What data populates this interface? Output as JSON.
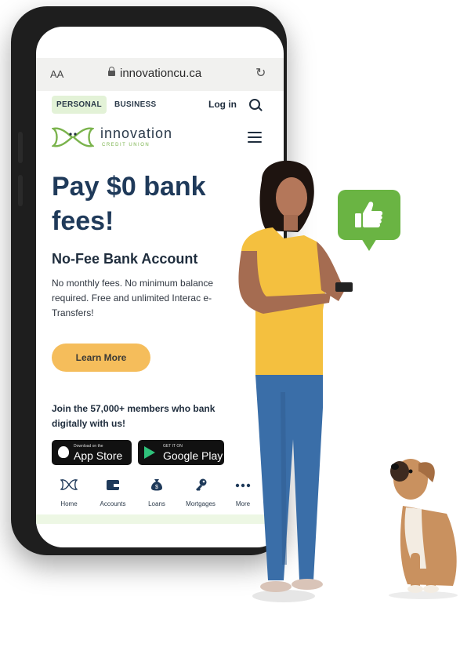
{
  "browser": {
    "text_size_label": "AA",
    "url": "innovationcu.ca"
  },
  "nav": {
    "personal": "PERSONAL",
    "business": "BUSINESS",
    "login": "Log in"
  },
  "logo": {
    "name": "innovation",
    "tagline": "CREDIT UNION"
  },
  "hero": {
    "title": "Pay $0 bank fees!",
    "subtitle": "No-Fee Bank Account",
    "description": "No monthly fees. No minimum balance required. Free and unlimited Interac e-Transfers!",
    "cta": "Learn More"
  },
  "join": {
    "text": "Join the 57,000+ members who bank digitally with us!"
  },
  "stores": {
    "apple_small": "Download on the",
    "apple_big": "App Store",
    "google_small": "GET IT ON",
    "google_big": "Google Play"
  },
  "bottom_nav": [
    {
      "label": "Home",
      "icon": "butterfly-icon"
    },
    {
      "label": "Accounts",
      "icon": "wallet-icon"
    },
    {
      "label": "Loans",
      "icon": "money-bag-icon"
    },
    {
      "label": "Mortgages",
      "icon": "key-icon"
    },
    {
      "label": "More",
      "icon": "more-dots-icon"
    }
  ],
  "colors": {
    "brand_green": "#7ab34c",
    "brand_navy": "#1f3a5a",
    "cta_orange": "#f5bd5b",
    "bubble_green": "#6ab443"
  }
}
